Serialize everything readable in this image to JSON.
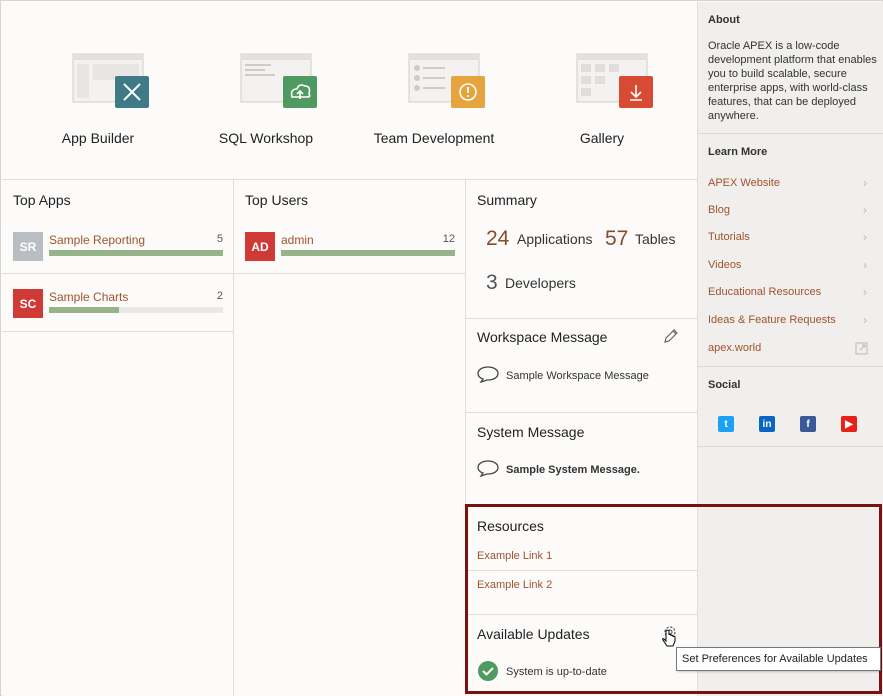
{
  "tiles": [
    {
      "label": "App Builder",
      "icon": "app-builder-icon",
      "color": "#3f7b86"
    },
    {
      "label": "SQL Workshop",
      "icon": "sql-workshop-icon",
      "color": "#4f9a61"
    },
    {
      "label": "Team Development",
      "icon": "team-development-icon",
      "color": "#e5a43e"
    },
    {
      "label": "Gallery",
      "icon": "gallery-icon",
      "color": "#d94a35"
    }
  ],
  "top_apps": {
    "title": "Top Apps",
    "rows": [
      {
        "initials": "SR",
        "name": "Sample Reporting",
        "count": "5",
        "fraction": 1.0,
        "color": "#b9bec4"
      },
      {
        "initials": "SC",
        "name": "Sample Charts",
        "count": "2",
        "fraction": 0.4,
        "color": "#cf3a36"
      }
    ]
  },
  "top_users": {
    "title": "Top Users",
    "rows": [
      {
        "initials": "AD",
        "name": "admin",
        "count": "12",
        "fraction": 1.0,
        "color": "#cf3a36"
      }
    ]
  },
  "summary": {
    "title": "Summary",
    "applications_count": "24",
    "applications_label": "Applications",
    "tables_count": "57",
    "tables_label": "Tables",
    "developers_count": "3",
    "developers_label": "Developers"
  },
  "workspace_message": {
    "title": "Workspace Message",
    "text": "Sample Workspace Message"
  },
  "system_message": {
    "title": "System Message",
    "text": "Sample System Message."
  },
  "resources": {
    "title": "Resources",
    "links": [
      "Example Link 1",
      "Example Link 2"
    ]
  },
  "updates": {
    "title": "Available Updates",
    "status": "System is up-to-date",
    "tooltip": "Set Preferences for Available Updates"
  },
  "sidebar": {
    "about_title": "About",
    "about_text": "Oracle APEX is a low-code development platform that enables you to build scalable, secure enterprise apps, with world-class features, that can be deployed anywhere.",
    "learn_title": "Learn More",
    "links": [
      "APEX Website",
      "Blog",
      "Tutorials",
      "Videos",
      "Educational Resources",
      "Ideas & Feature Requests",
      "apex.world"
    ],
    "social_title": "Social",
    "social": [
      {
        "icon": "twitter-icon",
        "color": "#1da1f2"
      },
      {
        "icon": "linkedin-icon",
        "color": "#0a66c2"
      },
      {
        "icon": "facebook-icon",
        "color": "#3b5998"
      },
      {
        "icon": "youtube-icon",
        "color": "#e62117"
      }
    ]
  }
}
